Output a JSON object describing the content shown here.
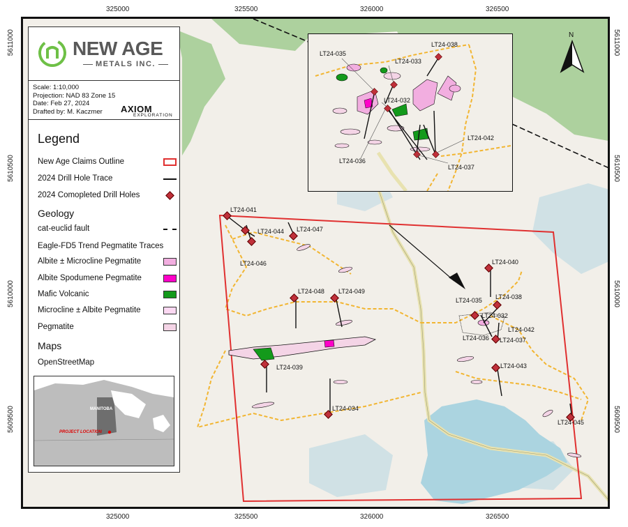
{
  "coords": {
    "top": [
      "325000",
      "325500",
      "326000",
      "326500"
    ],
    "bottom": [
      "325000",
      "325500",
      "326000",
      "326500"
    ],
    "left": [
      "5611000",
      "5610500",
      "5610000",
      "5609500"
    ],
    "right": [
      "5611000",
      "5610500",
      "5610000",
      "5609500"
    ]
  },
  "north_arrow": {
    "label": "N"
  },
  "logo": {
    "name": "NEW AGE",
    "sub": "METALS INC."
  },
  "info": {
    "scale": "Scale: 1:10,000",
    "projection": "Projection: NAD 83 Zone 15",
    "date": "Date: Feb 27, 2024",
    "drafted": "Drafted by: M. Kaczmer",
    "company": "AXIOM",
    "company_sub": "EXPLORATION"
  },
  "legend": {
    "title": "Legend",
    "items": [
      {
        "label": "New Age Claims Outline"
      },
      {
        "label": "2024 Drill Hole Trace"
      },
      {
        "label": "2024 Comopleted Drill Holes"
      }
    ],
    "geology_title": "Geology",
    "fault_label": "cat-euclid fault",
    "pegmatite_title": "Eagle-FD5 Trend Pegmatite Traces",
    "units": [
      {
        "label": "Albite ± Microcline Pegmatite",
        "color": "#f2aee0"
      },
      {
        "label": "Albite Spodumene Pegmatite",
        "color": "#ff00c8"
      },
      {
        "label": "Mafic Volcanic",
        "color": "#139a1b"
      },
      {
        "label": "Microcline ± Albite Pegmatite",
        "color": "#fcd8f2"
      },
      {
        "label": "Pegmatite",
        "color": "#f4d4e6"
      }
    ],
    "maps_title": "Maps",
    "basemap": "OpenStreetMap"
  },
  "inset": {
    "province": "MANITOBA",
    "location": "PROJECT LOCATION"
  },
  "drill_holes": [
    "LT24-041",
    "LT24-044",
    "LT24-047",
    "LT24-046",
    "LT24-048",
    "LT24-049",
    "LT24-039",
    "LT24-034",
    "LT24-040",
    "LT24-035",
    "LT24-038",
    "LT24-032",
    "LT24-036",
    "LT24-042",
    "LT24-037",
    "LT24-043",
    "LT24-045"
  ],
  "zoom_labels": [
    "LT24-038",
    "LT24-035",
    "LT24-033",
    "LT24-032",
    "LT24-036",
    "LT24-042",
    "LT24-037"
  ],
  "colors": {
    "claims": "#e03030",
    "road": "#f2b531",
    "water": "#abd4e0",
    "forest": "#add19e",
    "hole": "#c0303a"
  }
}
